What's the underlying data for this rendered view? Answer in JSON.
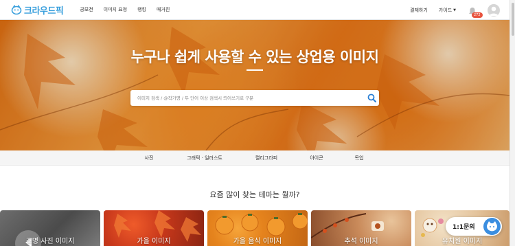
{
  "header": {
    "logo_text": "크라우드픽",
    "nav": [
      {
        "label": "공모전"
      },
      {
        "label": "이미지 요청"
      },
      {
        "label": "랭킹"
      },
      {
        "label": "매거진"
      }
    ],
    "pay_label": "결제하기",
    "guide_label": "가이드",
    "notification_count": "272"
  },
  "hero": {
    "title": "누구나 쉽게 사용할 수 있는 상업용 이미지",
    "search_placeholder": "이미지 검색 / @작가명 / 두 단어 이상 검색시 띄어쓰기로 구분"
  },
  "categories": [
    {
      "label": "사진"
    },
    {
      "label": "그래픽 · 일러스트"
    },
    {
      "label": "캘리그라피"
    },
    {
      "label": "아이콘"
    },
    {
      "label": "목업"
    }
  ],
  "section": {
    "title": "요즘 많이 찾는 테마는 뭘까?",
    "cards": [
      {
        "label": "조명 사진 이미지"
      },
      {
        "label": "가을 이미지"
      },
      {
        "label": "가을 음식 이미지"
      },
      {
        "label": "추석 이미지"
      },
      {
        "label": "유치원 이미지"
      }
    ]
  },
  "chat_widget": {
    "label": "1:1문의"
  },
  "colors": {
    "brand": "#3aa0dd",
    "badge": "#e8543f",
    "chat": "#3b8ee0"
  }
}
